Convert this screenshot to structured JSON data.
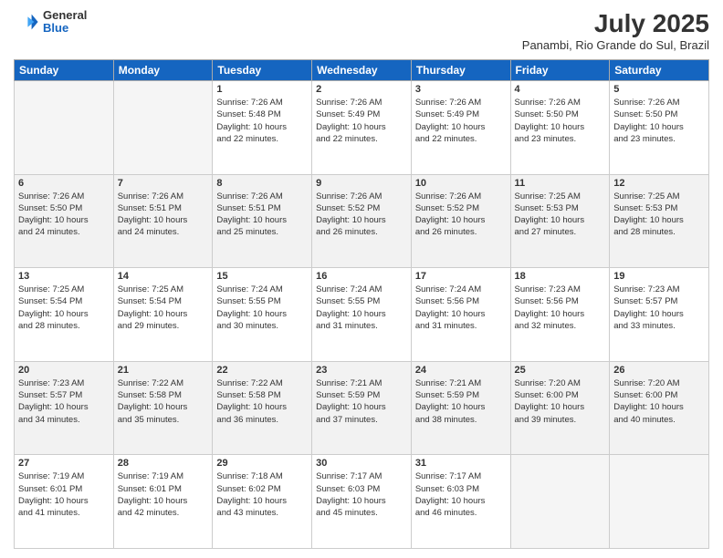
{
  "header": {
    "logo": {
      "general": "General",
      "blue": "Blue"
    },
    "title": "July 2025",
    "location": "Panambi, Rio Grande do Sul, Brazil"
  },
  "weekdays": [
    "Sunday",
    "Monday",
    "Tuesday",
    "Wednesday",
    "Thursday",
    "Friday",
    "Saturday"
  ],
  "weeks": [
    [
      {
        "day": "",
        "info": ""
      },
      {
        "day": "",
        "info": ""
      },
      {
        "day": "1",
        "info": "Sunrise: 7:26 AM\nSunset: 5:48 PM\nDaylight: 10 hours\nand 22 minutes."
      },
      {
        "day": "2",
        "info": "Sunrise: 7:26 AM\nSunset: 5:49 PM\nDaylight: 10 hours\nand 22 minutes."
      },
      {
        "day": "3",
        "info": "Sunrise: 7:26 AM\nSunset: 5:49 PM\nDaylight: 10 hours\nand 22 minutes."
      },
      {
        "day": "4",
        "info": "Sunrise: 7:26 AM\nSunset: 5:50 PM\nDaylight: 10 hours\nand 23 minutes."
      },
      {
        "day": "5",
        "info": "Sunrise: 7:26 AM\nSunset: 5:50 PM\nDaylight: 10 hours\nand 23 minutes."
      }
    ],
    [
      {
        "day": "6",
        "info": "Sunrise: 7:26 AM\nSunset: 5:50 PM\nDaylight: 10 hours\nand 24 minutes."
      },
      {
        "day": "7",
        "info": "Sunrise: 7:26 AM\nSunset: 5:51 PM\nDaylight: 10 hours\nand 24 minutes."
      },
      {
        "day": "8",
        "info": "Sunrise: 7:26 AM\nSunset: 5:51 PM\nDaylight: 10 hours\nand 25 minutes."
      },
      {
        "day": "9",
        "info": "Sunrise: 7:26 AM\nSunset: 5:52 PM\nDaylight: 10 hours\nand 26 minutes."
      },
      {
        "day": "10",
        "info": "Sunrise: 7:26 AM\nSunset: 5:52 PM\nDaylight: 10 hours\nand 26 minutes."
      },
      {
        "day": "11",
        "info": "Sunrise: 7:25 AM\nSunset: 5:53 PM\nDaylight: 10 hours\nand 27 minutes."
      },
      {
        "day": "12",
        "info": "Sunrise: 7:25 AM\nSunset: 5:53 PM\nDaylight: 10 hours\nand 28 minutes."
      }
    ],
    [
      {
        "day": "13",
        "info": "Sunrise: 7:25 AM\nSunset: 5:54 PM\nDaylight: 10 hours\nand 28 minutes."
      },
      {
        "day": "14",
        "info": "Sunrise: 7:25 AM\nSunset: 5:54 PM\nDaylight: 10 hours\nand 29 minutes."
      },
      {
        "day": "15",
        "info": "Sunrise: 7:24 AM\nSunset: 5:55 PM\nDaylight: 10 hours\nand 30 minutes."
      },
      {
        "day": "16",
        "info": "Sunrise: 7:24 AM\nSunset: 5:55 PM\nDaylight: 10 hours\nand 31 minutes."
      },
      {
        "day": "17",
        "info": "Sunrise: 7:24 AM\nSunset: 5:56 PM\nDaylight: 10 hours\nand 31 minutes."
      },
      {
        "day": "18",
        "info": "Sunrise: 7:23 AM\nSunset: 5:56 PM\nDaylight: 10 hours\nand 32 minutes."
      },
      {
        "day": "19",
        "info": "Sunrise: 7:23 AM\nSunset: 5:57 PM\nDaylight: 10 hours\nand 33 minutes."
      }
    ],
    [
      {
        "day": "20",
        "info": "Sunrise: 7:23 AM\nSunset: 5:57 PM\nDaylight: 10 hours\nand 34 minutes."
      },
      {
        "day": "21",
        "info": "Sunrise: 7:22 AM\nSunset: 5:58 PM\nDaylight: 10 hours\nand 35 minutes."
      },
      {
        "day": "22",
        "info": "Sunrise: 7:22 AM\nSunset: 5:58 PM\nDaylight: 10 hours\nand 36 minutes."
      },
      {
        "day": "23",
        "info": "Sunrise: 7:21 AM\nSunset: 5:59 PM\nDaylight: 10 hours\nand 37 minutes."
      },
      {
        "day": "24",
        "info": "Sunrise: 7:21 AM\nSunset: 5:59 PM\nDaylight: 10 hours\nand 38 minutes."
      },
      {
        "day": "25",
        "info": "Sunrise: 7:20 AM\nSunset: 6:00 PM\nDaylight: 10 hours\nand 39 minutes."
      },
      {
        "day": "26",
        "info": "Sunrise: 7:20 AM\nSunset: 6:00 PM\nDaylight: 10 hours\nand 40 minutes."
      }
    ],
    [
      {
        "day": "27",
        "info": "Sunrise: 7:19 AM\nSunset: 6:01 PM\nDaylight: 10 hours\nand 41 minutes."
      },
      {
        "day": "28",
        "info": "Sunrise: 7:19 AM\nSunset: 6:01 PM\nDaylight: 10 hours\nand 42 minutes."
      },
      {
        "day": "29",
        "info": "Sunrise: 7:18 AM\nSunset: 6:02 PM\nDaylight: 10 hours\nand 43 minutes."
      },
      {
        "day": "30",
        "info": "Sunrise: 7:17 AM\nSunset: 6:03 PM\nDaylight: 10 hours\nand 45 minutes."
      },
      {
        "day": "31",
        "info": "Sunrise: 7:17 AM\nSunset: 6:03 PM\nDaylight: 10 hours\nand 46 minutes."
      },
      {
        "day": "",
        "info": ""
      },
      {
        "day": "",
        "info": ""
      }
    ]
  ]
}
